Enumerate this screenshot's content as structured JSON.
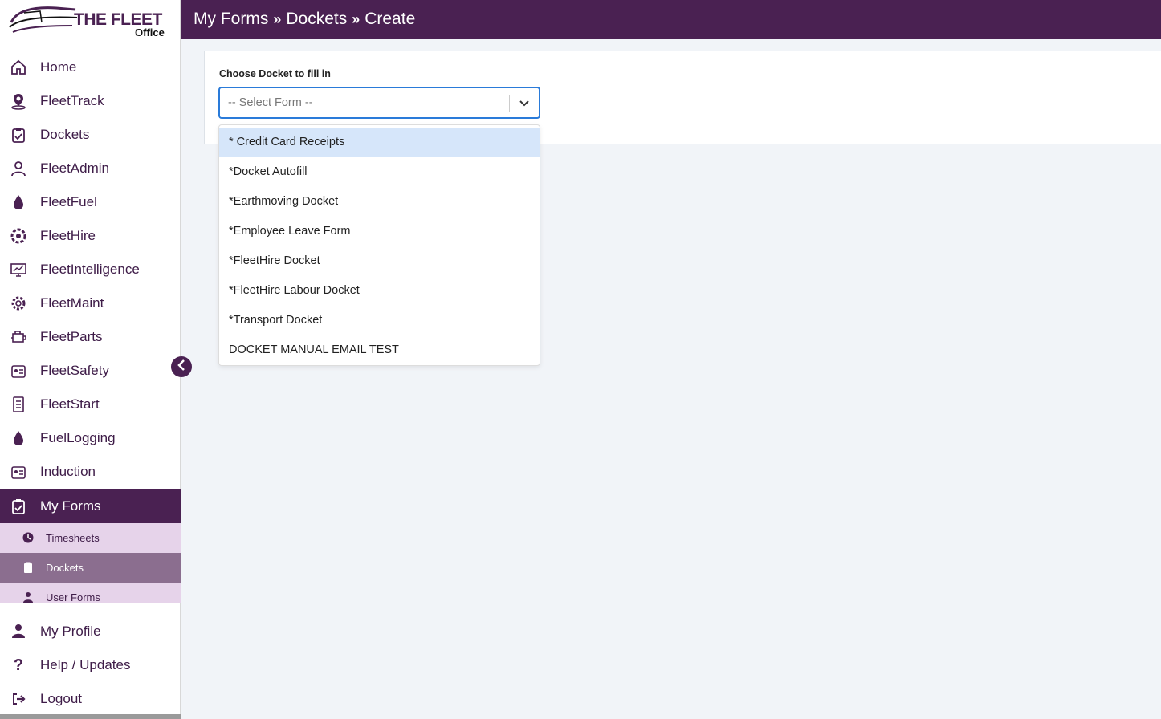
{
  "logo": {
    "brand": "THE FLEET",
    "sub": "Office"
  },
  "header": {
    "crumbs": [
      "My Forms",
      "Dockets",
      "Create"
    ]
  },
  "sidebar": {
    "items": [
      {
        "label": "Home",
        "icon": "home-icon"
      },
      {
        "label": "FleetTrack",
        "icon": "location-pin-icon"
      },
      {
        "label": "Dockets",
        "icon": "clipboard-check-icon"
      },
      {
        "label": "FleetAdmin",
        "icon": "user-cog-icon"
      },
      {
        "label": "FleetFuel",
        "icon": "droplet-icon"
      },
      {
        "label": "FleetHire",
        "icon": "hire-badge-icon"
      },
      {
        "label": "FleetIntelligence",
        "icon": "monitor-chart-icon"
      },
      {
        "label": "FleetMaint",
        "icon": "gears-icon"
      },
      {
        "label": "FleetParts",
        "icon": "engine-icon"
      },
      {
        "label": "FleetSafety",
        "icon": "id-card-icon"
      },
      {
        "label": "FleetStart",
        "icon": "checklist-icon"
      },
      {
        "label": "FuelLogging",
        "icon": "droplet-icon"
      },
      {
        "label": "Induction",
        "icon": "id-card-icon"
      },
      {
        "label": "My Forms",
        "icon": "clipboard-check-icon"
      }
    ],
    "sub_items": [
      {
        "label": "Timesheets",
        "icon": "clock-icon"
      },
      {
        "label": "Dockets",
        "icon": "clipboard-icon"
      },
      {
        "label": "User Forms",
        "icon": "user-icon"
      }
    ],
    "bottom_items": [
      {
        "label": "My Profile",
        "icon": "user-icon"
      },
      {
        "label": "Help / Updates",
        "icon": "question-icon"
      },
      {
        "label": "Logout",
        "icon": "logout-icon"
      }
    ]
  },
  "form": {
    "label": "Choose Docket to fill in",
    "placeholder": "-- Select Form --",
    "options": [
      "* Credit Card Receipts",
      "*Docket Autofill",
      "*Earthmoving Docket",
      "*Employee Leave Form",
      "*FleetHire Docket",
      "*FleetHire Labour Docket",
      "*Transport Docket",
      "DOCKET MANUAL EMAIL TEST"
    ]
  },
  "colors": {
    "brand": "#4a2152",
    "submenu": "#e6d3ea",
    "submenu_active": "#8b6e8f",
    "focus": "#2a7bd9",
    "highlight": "#d6e6fa"
  }
}
